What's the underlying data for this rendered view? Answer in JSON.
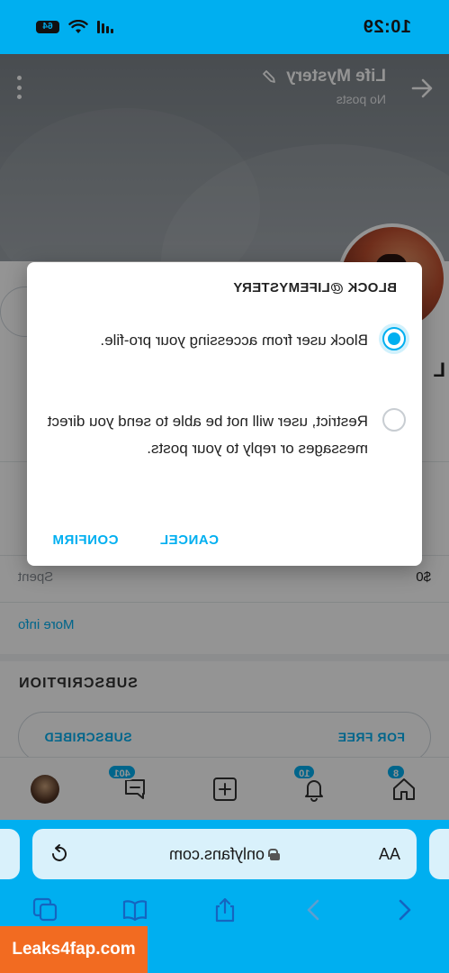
{
  "status_bar": {
    "time": "10:29",
    "battery": "64"
  },
  "header": {
    "title": "Life Mystery",
    "subtitle": "No posts"
  },
  "profile_peek": {
    "name_initial": "L",
    "spent_label": "Spent",
    "spent_value": "$0",
    "more_info": "More info",
    "subscription_heading": "SUBSCRIPTION",
    "subscribed_label": "SUBSCRIBED",
    "price_label": "FOR FREE"
  },
  "modal": {
    "title": "BLOCK @LIFEMYSTERY",
    "options": [
      {
        "label": "Block user from accessing your pro-file.",
        "selected": true
      },
      {
        "label": "Restrict, user will not be able to send you direct messages or reply to your posts.",
        "selected": false
      }
    ],
    "cancel_label": "CANCEL",
    "confirm_label": "CONFIRM"
  },
  "tab_bar": {
    "notifications_badge": "10",
    "messages_badge": "401",
    "home_badge": "8"
  },
  "browser": {
    "aa_label": "AA",
    "url": "onlyfans.com"
  },
  "watermark": "Leaks4fap.com",
  "colors": {
    "accent": "#00aff0",
    "watermark": "#f26b21"
  }
}
